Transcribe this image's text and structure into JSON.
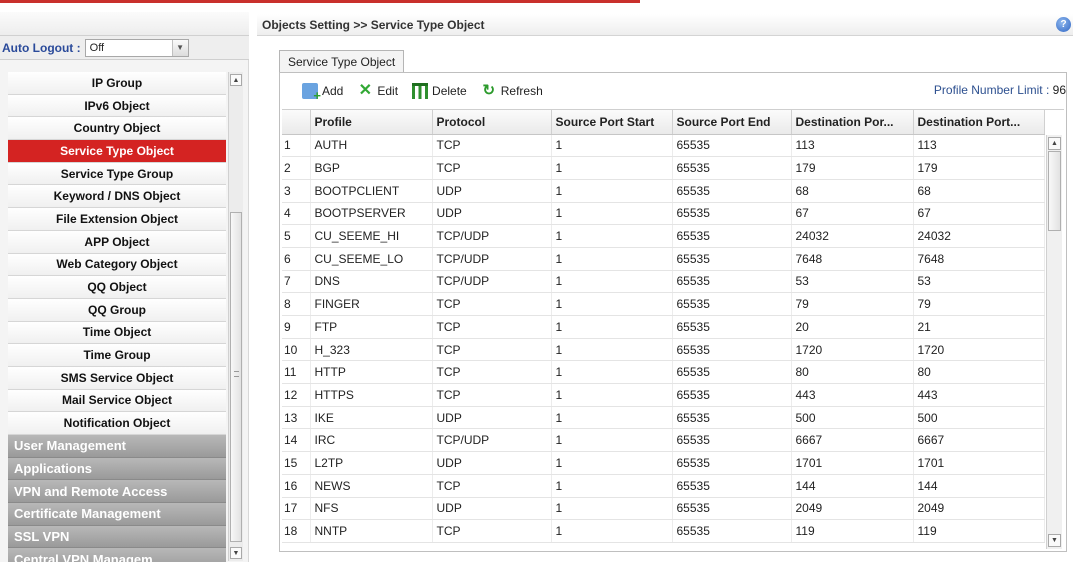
{
  "sidebar": {
    "auto_logout_label": "Auto Logout :",
    "auto_logout_value": "Off",
    "items": [
      {
        "label": "IP Group",
        "active": false
      },
      {
        "label": "IPv6 Object",
        "active": false
      },
      {
        "label": "Country Object",
        "active": false
      },
      {
        "label": "Service Type Object",
        "active": true
      },
      {
        "label": "Service Type Group",
        "active": false
      },
      {
        "label": "Keyword / DNS Object",
        "active": false
      },
      {
        "label": "File Extension Object",
        "active": false
      },
      {
        "label": "APP Object",
        "active": false
      },
      {
        "label": "Web Category Object",
        "active": false
      },
      {
        "label": "QQ Object",
        "active": false
      },
      {
        "label": "QQ Group",
        "active": false
      },
      {
        "label": "Time Object",
        "active": false
      },
      {
        "label": "Time Group",
        "active": false
      },
      {
        "label": "SMS Service Object",
        "active": false
      },
      {
        "label": "Mail Service Object",
        "active": false
      },
      {
        "label": "Notification Object",
        "active": false
      }
    ],
    "sections": [
      "User Management",
      "Applications",
      "VPN and Remote Access",
      "Certificate Management",
      "SSL VPN",
      "Central VPN Managem..."
    ]
  },
  "header": {
    "breadcrumb": "Objects Setting >> Service Type Object",
    "help_glyph": "?"
  },
  "main": {
    "tab_label": "Service Type Object",
    "toolbar": {
      "add_label": "Add",
      "edit_label": "Edit",
      "delete_label": "Delete",
      "refresh_label": "Refresh",
      "limit_label": "Profile Number Limit :",
      "limit_value": "96"
    },
    "columns": [
      "",
      "Profile",
      "Protocol",
      "Source Port Start",
      "Source Port End",
      "Destination Por...",
      "Destination Port..."
    ],
    "rows": [
      [
        "1",
        "AUTH",
        "TCP",
        "1",
        "65535",
        "113",
        "113"
      ],
      [
        "2",
        "BGP",
        "TCP",
        "1",
        "65535",
        "179",
        "179"
      ],
      [
        "3",
        "BOOTPCLIENT",
        "UDP",
        "1",
        "65535",
        "68",
        "68"
      ],
      [
        "4",
        "BOOTPSERVER",
        "UDP",
        "1",
        "65535",
        "67",
        "67"
      ],
      [
        "5",
        "CU_SEEME_HI",
        "TCP/UDP",
        "1",
        "65535",
        "24032",
        "24032"
      ],
      [
        "6",
        "CU_SEEME_LO",
        "TCP/UDP",
        "1",
        "65535",
        "7648",
        "7648"
      ],
      [
        "7",
        "DNS",
        "TCP/UDP",
        "1",
        "65535",
        "53",
        "53"
      ],
      [
        "8",
        "FINGER",
        "TCP",
        "1",
        "65535",
        "79",
        "79"
      ],
      [
        "9",
        "FTP",
        "TCP",
        "1",
        "65535",
        "20",
        "21"
      ],
      [
        "10",
        "H_323",
        "TCP",
        "1",
        "65535",
        "1720",
        "1720"
      ],
      [
        "11",
        "HTTP",
        "TCP",
        "1",
        "65535",
        "80",
        "80"
      ],
      [
        "12",
        "HTTPS",
        "TCP",
        "1",
        "65535",
        "443",
        "443"
      ],
      [
        "13",
        "IKE",
        "UDP",
        "1",
        "65535",
        "500",
        "500"
      ],
      [
        "14",
        "IRC",
        "TCP/UDP",
        "1",
        "65535",
        "6667",
        "6667"
      ],
      [
        "15",
        "L2TP",
        "UDP",
        "1",
        "65535",
        "1701",
        "1701"
      ],
      [
        "16",
        "NEWS",
        "TCP",
        "1",
        "65535",
        "144",
        "144"
      ],
      [
        "17",
        "NFS",
        "UDP",
        "1",
        "65535",
        "2049",
        "2049"
      ],
      [
        "18",
        "NNTP",
        "TCP",
        "1",
        "65535",
        "119",
        "119"
      ]
    ]
  },
  "colors": {
    "active_item": "#d42322",
    "section_bg": "#a8a8a8",
    "link_blue": "#2c4f8f"
  }
}
